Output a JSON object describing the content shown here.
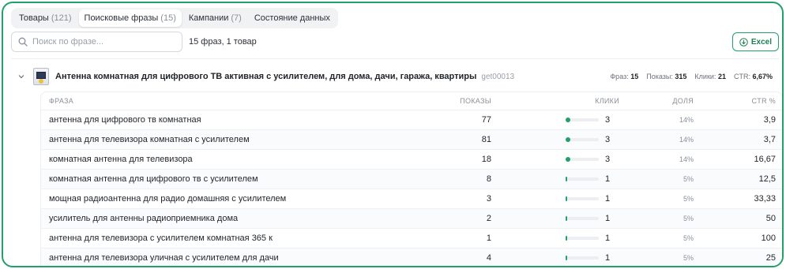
{
  "tabs": [
    {
      "label": "Товары",
      "count": "(121)",
      "active": false
    },
    {
      "label": "Поисковые фразы",
      "count": "(15)",
      "active": true
    },
    {
      "label": "Кампании",
      "count": "(7)",
      "active": false
    },
    {
      "label": "Состояние данных",
      "count": "",
      "active": false
    }
  ],
  "search": {
    "placeholder": "Поиск по фразе...",
    "value": ""
  },
  "summary": "15 фраз, 1 товар",
  "excel_label": "Excel",
  "product": {
    "title": "Антенна комнатная для цифрового ТВ активная с усилителем, для дома, дачи, гаража, квартиры",
    "id": "get00013",
    "stats": [
      {
        "label": "Фраз:",
        "value": "15"
      },
      {
        "label": "Показы:",
        "value": "315"
      },
      {
        "label": "Клики:",
        "value": "21"
      },
      {
        "label": "CTR:",
        "value": "6,67%"
      }
    ]
  },
  "table": {
    "headers": {
      "phrase": "Фраза",
      "shows": "Показы",
      "clicks": "Клики",
      "share": "Доля",
      "ctr": "CTR %"
    },
    "rows": [
      {
        "phrase": "антенна для цифрового тв комнатная",
        "shows": "77",
        "clicks": "3",
        "bar": 0.14,
        "share": "14%",
        "ctr": "3,9"
      },
      {
        "phrase": "антенна для телевизора комнатная с усилителем",
        "shows": "81",
        "clicks": "3",
        "bar": 0.14,
        "share": "14%",
        "ctr": "3,7"
      },
      {
        "phrase": "комнатная антенна для телевизора",
        "shows": "18",
        "clicks": "3",
        "bar": 0.14,
        "share": "14%",
        "ctr": "16,67"
      },
      {
        "phrase": "комнатная антенна для цифрового тв с усилителем",
        "shows": "8",
        "clicks": "1",
        "bar": 0.05,
        "share": "5%",
        "ctr": "12,5"
      },
      {
        "phrase": "мощная радиоантенна для радио домашняя с усилителем",
        "shows": "3",
        "clicks": "1",
        "bar": 0.05,
        "share": "5%",
        "ctr": "33,33"
      },
      {
        "phrase": "усилитель для антенны радиоприемника дома",
        "shows": "2",
        "clicks": "1",
        "bar": 0.05,
        "share": "5%",
        "ctr": "50"
      },
      {
        "phrase": "антенна для телевизора с усилителем комнатная 365 к",
        "shows": "1",
        "clicks": "1",
        "bar": 0.05,
        "share": "5%",
        "ctr": "100"
      },
      {
        "phrase": "антенна для телевизора уличная с усилителем для дачи",
        "shows": "4",
        "clicks": "1",
        "bar": 0.05,
        "share": "5%",
        "ctr": "25"
      }
    ]
  }
}
